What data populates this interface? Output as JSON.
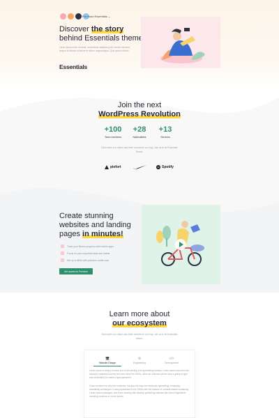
{
  "header": {
    "brand_label": "For Hoax Essentials ⌄",
    "logo_colors": [
      "#f4a9b4",
      "#f6a36b",
      "#2a3042",
      "#8fc7e8"
    ]
  },
  "hero": {
    "title_pre": "Discover ",
    "title_hl": "the story",
    "title_post": "behind Essentials theme",
    "text": "Lorem ipsum dolor sit amet, consectetur adipiscing elit, sed do eiusmod tempor incididunt ut labore et dolore magna aliqua. Quis ipsum ultrices.",
    "essentials": "Essentials"
  },
  "join": {
    "title_pre": "Join the next",
    "title_hl": "WordPress Revolution",
    "stats": [
      {
        "num": "+100",
        "label": "Team members"
      },
      {
        "num": "+28",
        "label": "Nationalities"
      },
      {
        "num": "+13",
        "label": "Services"
      }
    ],
    "text": "Each week our editors add fresh content for our blog. Join us to be Essentials Theme.",
    "brands": [
      {
        "name": "piefort",
        "icon": "piefort-icon"
      },
      {
        "name": "",
        "icon": "nike-swoosh-icon"
      },
      {
        "name": "Spotify",
        "icon": "spotify-icon"
      }
    ]
  },
  "create": {
    "title_pre": "Create stunning websites and landing pages ",
    "title_hl": "in minutes!",
    "checks": [
      "Track your fitness progress with mobile apps",
      "Focus on your important stats and habits",
      "Set up to $50k with premium credit card"
    ],
    "cta": "Get access to Premium"
  },
  "learn": {
    "title_pre": "Learn more about",
    "title_hl": "our ecosystem",
    "text": "Each week our editors add fresh content for our blog. Join us to be Essentials theme.",
    "tabs": [
      {
        "label": "Website Design",
        "icon": "🖥"
      },
      {
        "label": "Engineering",
        "icon": "⚙"
      },
      {
        "label": "Development",
        "icon": "</>"
      }
    ],
    "para1": "Lorem ipsum is simply dummy text of the printing and typesetting industry. Lorem ipsum has been the industry's standard dummy text ever since the 1500s, when an unknown printer took a galley of type and scrambled it to make a type specimen.",
    "para2": "It has survived not only five centuries, but also the leap into electronic typesetting, remaining essentially unchanged. It was popularised in the 1960s with the release of Letraset sheets containing Lorem Ipsum passages, and more recently with desktop publishing software like Aldus PageMaker including versions of Lorem Ipsum."
  },
  "colors": {
    "accent": "#2f8e6d",
    "highlight": "#ffd84a",
    "hero_illus_bg": "#fce7ea",
    "create_illus_bg": "#dff3e9"
  }
}
